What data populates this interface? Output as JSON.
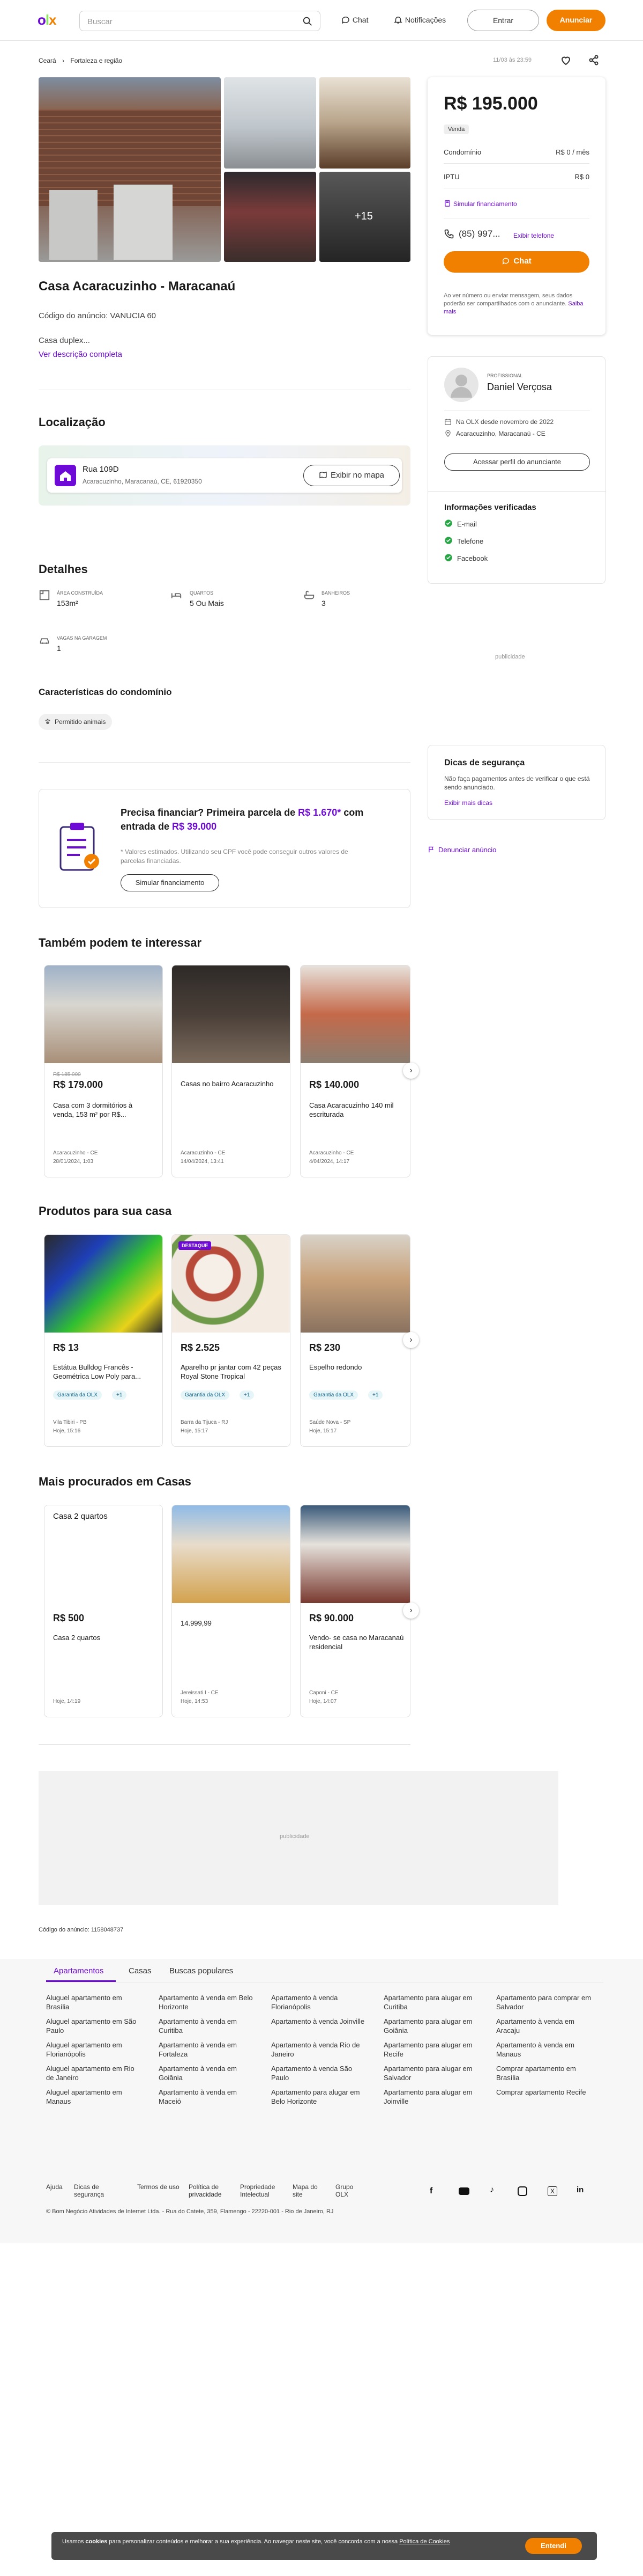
{
  "header": {
    "search_placeholder": "Buscar",
    "chat": "Chat",
    "notifications": "Notificações",
    "login": "Entrar",
    "advertise": "Anunciar"
  },
  "breadcrumb": {
    "a": "Ceará",
    "b": "Fortaleza e região"
  },
  "meta": {
    "date": "11/03 às 23:59"
  },
  "gallery": {
    "more": "+15"
  },
  "listing": {
    "title": "Casa Acaracuzinho - Maracanaú",
    "code": "Código do anúncio: VANUCIA 60",
    "desc": "Casa duplex...",
    "see_more": "Ver descrição completa"
  },
  "location": {
    "title": "Localização",
    "street": "Rua 109D",
    "address": "Acaracuzinho, Maracanaú, CE, 61920350",
    "map_btn": "Exibir no mapa"
  },
  "details": {
    "title": "Detalhes",
    "items": [
      {
        "label": "ÁREA CONSTRUÍDA",
        "value": "153m²"
      },
      {
        "label": "QUARTOS",
        "value": "5 Ou Mais"
      },
      {
        "label": "BANHEIROS",
        "value": "3"
      },
      {
        "label": "VAGAS NA GARAGEM",
        "value": "1"
      }
    ]
  },
  "condo": {
    "title": "Características do condomínio",
    "chip": "Permitido animais"
  },
  "finance": {
    "title_a": "Precisa financiar? Primeira parcela de ",
    "title_b": "R$ 1.670*",
    "title_c": " com entrada de ",
    "title_d": "R$ 39.000",
    "note": "* Valores estimados. Utilizando seu CPF você pode conseguir outros valores de parcelas financiadas.",
    "btn": "Simular financiamento"
  },
  "price_box": {
    "price": "R$ 195.000",
    "badge": "Venda",
    "condo_label": "Condomínio",
    "condo_value": "R$ 0 / mês",
    "iptu_label": "IPTU",
    "iptu_value": "R$ 0",
    "simulate": "Simular financiamento",
    "phone": "(85) 997...",
    "show_phone": "Exibir telefone",
    "chat": "Chat",
    "privacy": "Ao ver número ou enviar mensagem, seus dados poderão ser compartilhados com o anunciante.",
    "privacy_link": "Saiba mais"
  },
  "seller": {
    "role": "PROFISSIONAL",
    "name": "Daniel Verçosa",
    "since": "Na OLX desde novembro de 2022",
    "location": "Acaracuzinho, Maracanaú - CE",
    "profile_btn": "Acessar perfil do anunciante",
    "verified_title": "Informações verificadas",
    "verified": [
      "E-mail",
      "Telefone",
      "Facebook"
    ]
  },
  "ad_label": "publicidade",
  "safety": {
    "title": "Dicas de segurança",
    "text": "Não faça pagamentos antes de verificar o que está sendo anunciado.",
    "link": "Exibir mais dicas",
    "report": "Denunciar anúncio"
  },
  "similar": {
    "title": "Também podem te interessar",
    "items": [
      {
        "old": "R$ 185.000",
        "price": "R$ 179.000",
        "title": "Casa com 3 dormitórios à venda, 153 m² por R$...",
        "loc": "Acaracuzinho - CE",
        "date": "28/01/2024, 1:03"
      },
      {
        "old": "",
        "price": "",
        "title": "Casas no bairro Acaracuzinho",
        "loc": "Acaracuzinho - CE",
        "date": "14/04/2024, 13:41"
      },
      {
        "old": "",
        "price": "R$ 140.000",
        "title": "Casa Acaracuzinho 140 mil escriturada",
        "loc": "Acaracuzinho - CE",
        "date": "4/04/2024, 14:17"
      }
    ]
  },
  "products": {
    "title": "Produtos para sua casa",
    "items": [
      {
        "badge": "",
        "price": "R$ 13",
        "title": "Estátua Bulldog Francês - Geométrica Low Poly para...",
        "tag": "Garantia da OLX",
        "plus": "+1",
        "loc": "Vila Tibiri - PB",
        "date": "Hoje, 15:16"
      },
      {
        "badge": "DESTAQUE",
        "price": "R$ 2.525",
        "title": "Aparelho pr jantar com 42 peças Royal Stone Tropical",
        "tag": "Garantia da OLX",
        "plus": "+1",
        "loc": "Barra da Tijuca - RJ",
        "date": "Hoje, 15:17"
      },
      {
        "badge": "",
        "price": "R$ 230",
        "title": "Espelho redondo",
        "tag": "Garantia da OLX",
        "plus": "+1",
        "loc": "Saúde Nova - SP",
        "date": "Hoje, 15:17"
      }
    ]
  },
  "popular": {
    "title": "Mais procurados em Casas",
    "items": [
      {
        "head": "Casa 2 quartos",
        "price": "R$ 500",
        "title": "Casa 2 quartos",
        "loc": "",
        "date": "Hoje, 14:19"
      },
      {
        "head": "",
        "price": "",
        "title": "14.999,99",
        "loc": "Jereissati I - CE",
        "date": "Hoje, 14:53"
      },
      {
        "head": "",
        "price": "R$ 90.000",
        "title": "Vendo- se casa no Maracanaú residencial",
        "loc": "Caponi - CE",
        "date": "Hoje, 14:07"
      }
    ]
  },
  "ad_code": "Código do anúncio: 1158048737",
  "footer": {
    "tabs": [
      "Apartamentos",
      "Casas",
      "Buscas populares"
    ],
    "links": [
      "Aluguel apartamento em Brasília",
      "Apartamento à venda em Belo Horizonte",
      "Apartamento à venda Florianópolis",
      "Apartamento para alugar em Curitiba",
      "Apartamento para comprar em Salvador",
      "Aluguel apartamento em São Paulo",
      "Apartamento à venda em Curitiba",
      "Apartamento à venda Joinville",
      "Apartamento para alugar em Goiânia",
      "Apartamento à venda em Aracaju",
      "Aluguel apartamento em Florianópolis",
      "Apartamento à venda em Fortaleza",
      "Apartamento à venda Rio de Janeiro",
      "Apartamento para alugar em Recife",
      "Apartamento à venda em Manaus",
      "Aluguel apartamento em Rio de Janeiro",
      "Apartamento à venda em Goiânia",
      "Apartamento à venda São Paulo",
      "Apartamento para alugar em Salvador",
      "Comprar apartamento em Brasília",
      "Aluguel apartamento em Manaus",
      "Apartamento à venda em Maceió",
      "Apartamento para alugar em Belo Horizonte",
      "Apartamento para alugar em Joinville",
      "Comprar apartamento Recife"
    ],
    "bottom": [
      "Ajuda",
      "Dicas de segurança",
      "Termos de uso",
      "Política de privacidade",
      "Propriedade Intelectual",
      "Mapa do site",
      "Grupo OLX"
    ],
    "copyright": "© Bom Negócio Atividades de Internet Ltda. - Rua do Catete, 359, Flamengo - 22220-001 - Rio de Janeiro, RJ"
  },
  "cookie": {
    "text_a": "Usamos ",
    "text_b": "cookies",
    "text_c": " para personalizar conteúdos e melhorar a sua experiência. Ao navegar neste site, você concorda com a nossa ",
    "link": "Política de Cookies",
    "btn": "Entendi"
  }
}
